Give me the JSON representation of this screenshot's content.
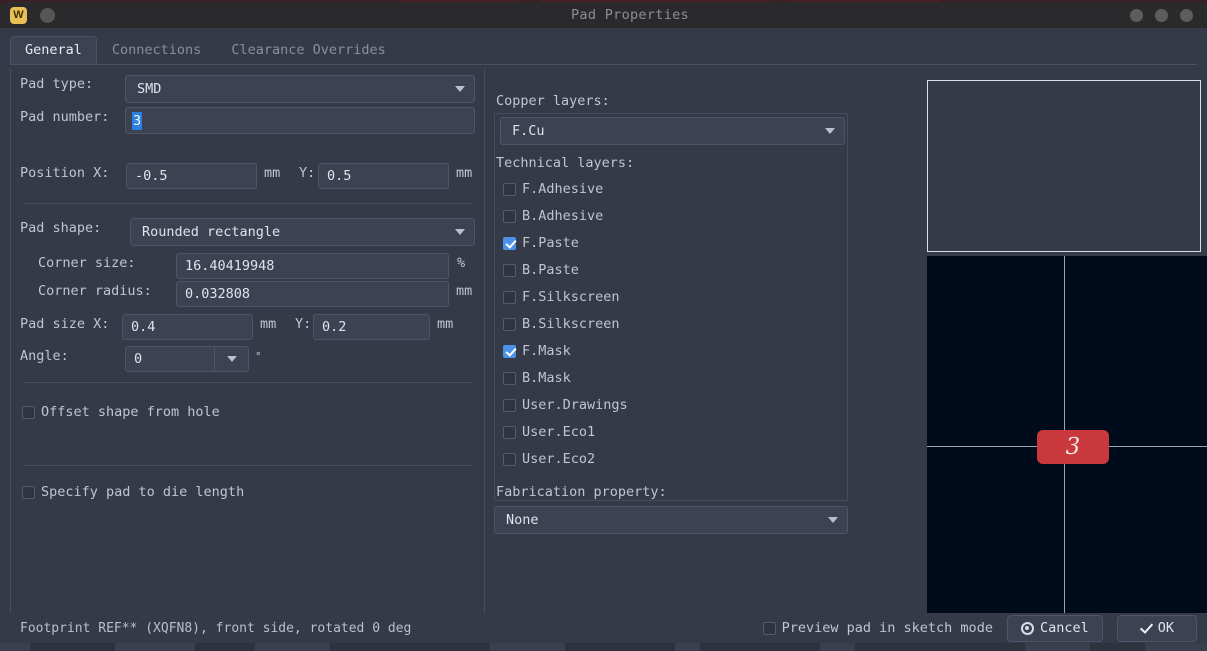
{
  "titlebar": {
    "app_badge": "W",
    "title": "Pad Properties"
  },
  "tabs": [
    {
      "label": "General",
      "active": true
    },
    {
      "label": "Connections",
      "active": false
    },
    {
      "label": "Clearance Overrides",
      "active": false
    }
  ],
  "general": {
    "pad_type_label": "Pad type:",
    "pad_type_value": "SMD",
    "pad_number_label": "Pad number:",
    "pad_number_value": "3",
    "position_x_label": "Position X:",
    "position_x_value": "-0.5",
    "position_x_unit": "mm",
    "position_y_label": "Y:",
    "position_y_value": "0.5",
    "position_y_unit": "mm",
    "pad_shape_label": "Pad shape:",
    "pad_shape_value": "Rounded rectangle",
    "corner_size_label": "Corner size:",
    "corner_size_value": "16.40419948",
    "corner_size_unit": "%",
    "corner_radius_label": "Corner radius:",
    "corner_radius_value": "0.032808",
    "corner_radius_unit": "mm",
    "pad_size_x_label": "Pad size X:",
    "pad_size_x_value": "0.4",
    "pad_size_x_unit": "mm",
    "pad_size_y_label": "Y:",
    "pad_size_y_value": "0.2",
    "pad_size_y_unit": "mm",
    "angle_label": "Angle:",
    "angle_value": "0",
    "angle_unit": "°",
    "offset_shape_label": "Offset shape from hole",
    "offset_shape_checked": false,
    "die_length_label": "Specify pad to die length",
    "die_length_checked": false
  },
  "layers": {
    "copper_label": "Copper layers:",
    "copper_value": "F.Cu",
    "technical_label": "Technical layers:",
    "technical_items": [
      {
        "label": "F.Adhesive",
        "checked": false
      },
      {
        "label": "B.Adhesive",
        "checked": false
      },
      {
        "label": "F.Paste",
        "checked": true
      },
      {
        "label": "B.Paste",
        "checked": false
      },
      {
        "label": "F.Silkscreen",
        "checked": false
      },
      {
        "label": "B.Silkscreen",
        "checked": false
      },
      {
        "label": "F.Mask",
        "checked": true
      },
      {
        "label": "B.Mask",
        "checked": false
      },
      {
        "label": "User.Drawings",
        "checked": false
      },
      {
        "label": "User.Eco1",
        "checked": false
      },
      {
        "label": "User.Eco2",
        "checked": false
      }
    ],
    "fabrication_label": "Fabrication property:",
    "fabrication_value": "None"
  },
  "preview": {
    "pad_number": "3",
    "pad_color": "#c8383c",
    "canvas_background": "#000c1b"
  },
  "bottom": {
    "status": "Footprint REF** (XQFN8), front side, rotated 0 deg",
    "sketch_label": "Preview pad in sketch mode",
    "sketch_checked": false,
    "cancel_label": "Cancel",
    "ok_label": "OK"
  }
}
